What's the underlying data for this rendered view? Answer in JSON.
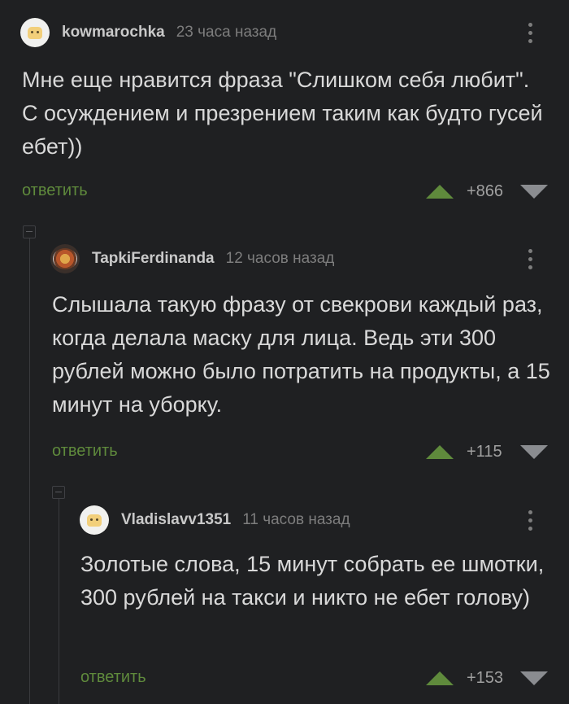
{
  "comments": [
    {
      "username": "kowmarochka",
      "time": "23 часа назад",
      "text": "Мне еще нравится фраза \"Слишком себя любит\". С осуждением и презрением таким как будто гусей ебет))",
      "reply_label": "ответить",
      "score": "+866",
      "avatar": "sweater-avatar-icon"
    },
    {
      "username": "TapkiFerdinanda",
      "time": "12 часов назад",
      "text": "Слышала такую фразу от свекрови каждый раз, когда делала маску для лица. Ведь эти 300 рублей можно было потратить на продукты, а 15 минут на уборку.",
      "reply_label": "ответить",
      "score": "+115",
      "avatar": "food-avatar-icon"
    },
    {
      "username": "Vladislavv1351",
      "time": "11 часов назад",
      "text": "Золотые слова, 15 минут собрать ее шмотки, 300 рублей на такси и никто не ебет голову)",
      "reply_label": "ответить",
      "score": "+153",
      "avatar": "sweater-avatar-icon"
    }
  ],
  "colors": {
    "background": "#1f2022",
    "accent": "#5f8a3c",
    "text": "#d9d9d9",
    "muted": "#7d7d7d"
  }
}
